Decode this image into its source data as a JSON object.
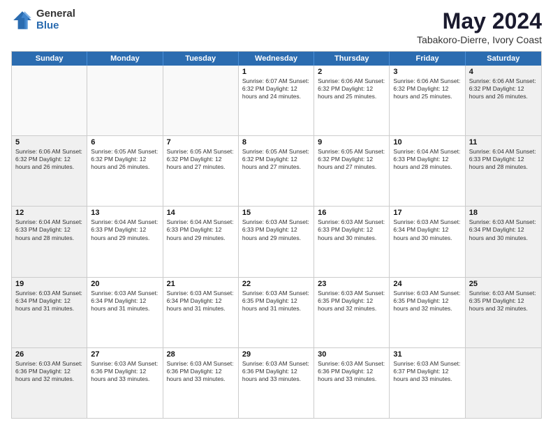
{
  "logo": {
    "general": "General",
    "blue": "Blue"
  },
  "header": {
    "title": "May 2024",
    "subtitle": "Tabakoro-Dierre, Ivory Coast"
  },
  "weekdays": [
    "Sunday",
    "Monday",
    "Tuesday",
    "Wednesday",
    "Thursday",
    "Friday",
    "Saturday"
  ],
  "rows": [
    [
      {
        "day": "",
        "info": "",
        "empty": true
      },
      {
        "day": "",
        "info": "",
        "empty": true
      },
      {
        "day": "",
        "info": "",
        "empty": true
      },
      {
        "day": "1",
        "info": "Sunrise: 6:07 AM\nSunset: 6:32 PM\nDaylight: 12 hours\nand 24 minutes.",
        "empty": false
      },
      {
        "day": "2",
        "info": "Sunrise: 6:06 AM\nSunset: 6:32 PM\nDaylight: 12 hours\nand 25 minutes.",
        "empty": false
      },
      {
        "day": "3",
        "info": "Sunrise: 6:06 AM\nSunset: 6:32 PM\nDaylight: 12 hours\nand 25 minutes.",
        "empty": false
      },
      {
        "day": "4",
        "info": "Sunrise: 6:06 AM\nSunset: 6:32 PM\nDaylight: 12 hours\nand 26 minutes.",
        "empty": false,
        "shaded": true
      }
    ],
    [
      {
        "day": "5",
        "info": "Sunrise: 6:06 AM\nSunset: 6:32 PM\nDaylight: 12 hours\nand 26 minutes.",
        "empty": false,
        "shaded": true
      },
      {
        "day": "6",
        "info": "Sunrise: 6:05 AM\nSunset: 6:32 PM\nDaylight: 12 hours\nand 26 minutes.",
        "empty": false
      },
      {
        "day": "7",
        "info": "Sunrise: 6:05 AM\nSunset: 6:32 PM\nDaylight: 12 hours\nand 27 minutes.",
        "empty": false
      },
      {
        "day": "8",
        "info": "Sunrise: 6:05 AM\nSunset: 6:32 PM\nDaylight: 12 hours\nand 27 minutes.",
        "empty": false
      },
      {
        "day": "9",
        "info": "Sunrise: 6:05 AM\nSunset: 6:32 PM\nDaylight: 12 hours\nand 27 minutes.",
        "empty": false
      },
      {
        "day": "10",
        "info": "Sunrise: 6:04 AM\nSunset: 6:33 PM\nDaylight: 12 hours\nand 28 minutes.",
        "empty": false
      },
      {
        "day": "11",
        "info": "Sunrise: 6:04 AM\nSunset: 6:33 PM\nDaylight: 12 hours\nand 28 minutes.",
        "empty": false,
        "shaded": true
      }
    ],
    [
      {
        "day": "12",
        "info": "Sunrise: 6:04 AM\nSunset: 6:33 PM\nDaylight: 12 hours\nand 28 minutes.",
        "empty": false,
        "shaded": true
      },
      {
        "day": "13",
        "info": "Sunrise: 6:04 AM\nSunset: 6:33 PM\nDaylight: 12 hours\nand 29 minutes.",
        "empty": false
      },
      {
        "day": "14",
        "info": "Sunrise: 6:04 AM\nSunset: 6:33 PM\nDaylight: 12 hours\nand 29 minutes.",
        "empty": false
      },
      {
        "day": "15",
        "info": "Sunrise: 6:03 AM\nSunset: 6:33 PM\nDaylight: 12 hours\nand 29 minutes.",
        "empty": false
      },
      {
        "day": "16",
        "info": "Sunrise: 6:03 AM\nSunset: 6:33 PM\nDaylight: 12 hours\nand 30 minutes.",
        "empty": false
      },
      {
        "day": "17",
        "info": "Sunrise: 6:03 AM\nSunset: 6:34 PM\nDaylight: 12 hours\nand 30 minutes.",
        "empty": false
      },
      {
        "day": "18",
        "info": "Sunrise: 6:03 AM\nSunset: 6:34 PM\nDaylight: 12 hours\nand 30 minutes.",
        "empty": false,
        "shaded": true
      }
    ],
    [
      {
        "day": "19",
        "info": "Sunrise: 6:03 AM\nSunset: 6:34 PM\nDaylight: 12 hours\nand 31 minutes.",
        "empty": false,
        "shaded": true
      },
      {
        "day": "20",
        "info": "Sunrise: 6:03 AM\nSunset: 6:34 PM\nDaylight: 12 hours\nand 31 minutes.",
        "empty": false
      },
      {
        "day": "21",
        "info": "Sunrise: 6:03 AM\nSunset: 6:34 PM\nDaylight: 12 hours\nand 31 minutes.",
        "empty": false
      },
      {
        "day": "22",
        "info": "Sunrise: 6:03 AM\nSunset: 6:35 PM\nDaylight: 12 hours\nand 31 minutes.",
        "empty": false
      },
      {
        "day": "23",
        "info": "Sunrise: 6:03 AM\nSunset: 6:35 PM\nDaylight: 12 hours\nand 32 minutes.",
        "empty": false
      },
      {
        "day": "24",
        "info": "Sunrise: 6:03 AM\nSunset: 6:35 PM\nDaylight: 12 hours\nand 32 minutes.",
        "empty": false
      },
      {
        "day": "25",
        "info": "Sunrise: 6:03 AM\nSunset: 6:35 PM\nDaylight: 12 hours\nand 32 minutes.",
        "empty": false,
        "shaded": true
      }
    ],
    [
      {
        "day": "26",
        "info": "Sunrise: 6:03 AM\nSunset: 6:36 PM\nDaylight: 12 hours\nand 32 minutes.",
        "empty": false,
        "shaded": true
      },
      {
        "day": "27",
        "info": "Sunrise: 6:03 AM\nSunset: 6:36 PM\nDaylight: 12 hours\nand 33 minutes.",
        "empty": false
      },
      {
        "day": "28",
        "info": "Sunrise: 6:03 AM\nSunset: 6:36 PM\nDaylight: 12 hours\nand 33 minutes.",
        "empty": false
      },
      {
        "day": "29",
        "info": "Sunrise: 6:03 AM\nSunset: 6:36 PM\nDaylight: 12 hours\nand 33 minutes.",
        "empty": false
      },
      {
        "day": "30",
        "info": "Sunrise: 6:03 AM\nSunset: 6:36 PM\nDaylight: 12 hours\nand 33 minutes.",
        "empty": false
      },
      {
        "day": "31",
        "info": "Sunrise: 6:03 AM\nSunset: 6:37 PM\nDaylight: 12 hours\nand 33 minutes.",
        "empty": false
      },
      {
        "day": "",
        "info": "",
        "empty": true,
        "shaded": true
      }
    ]
  ]
}
